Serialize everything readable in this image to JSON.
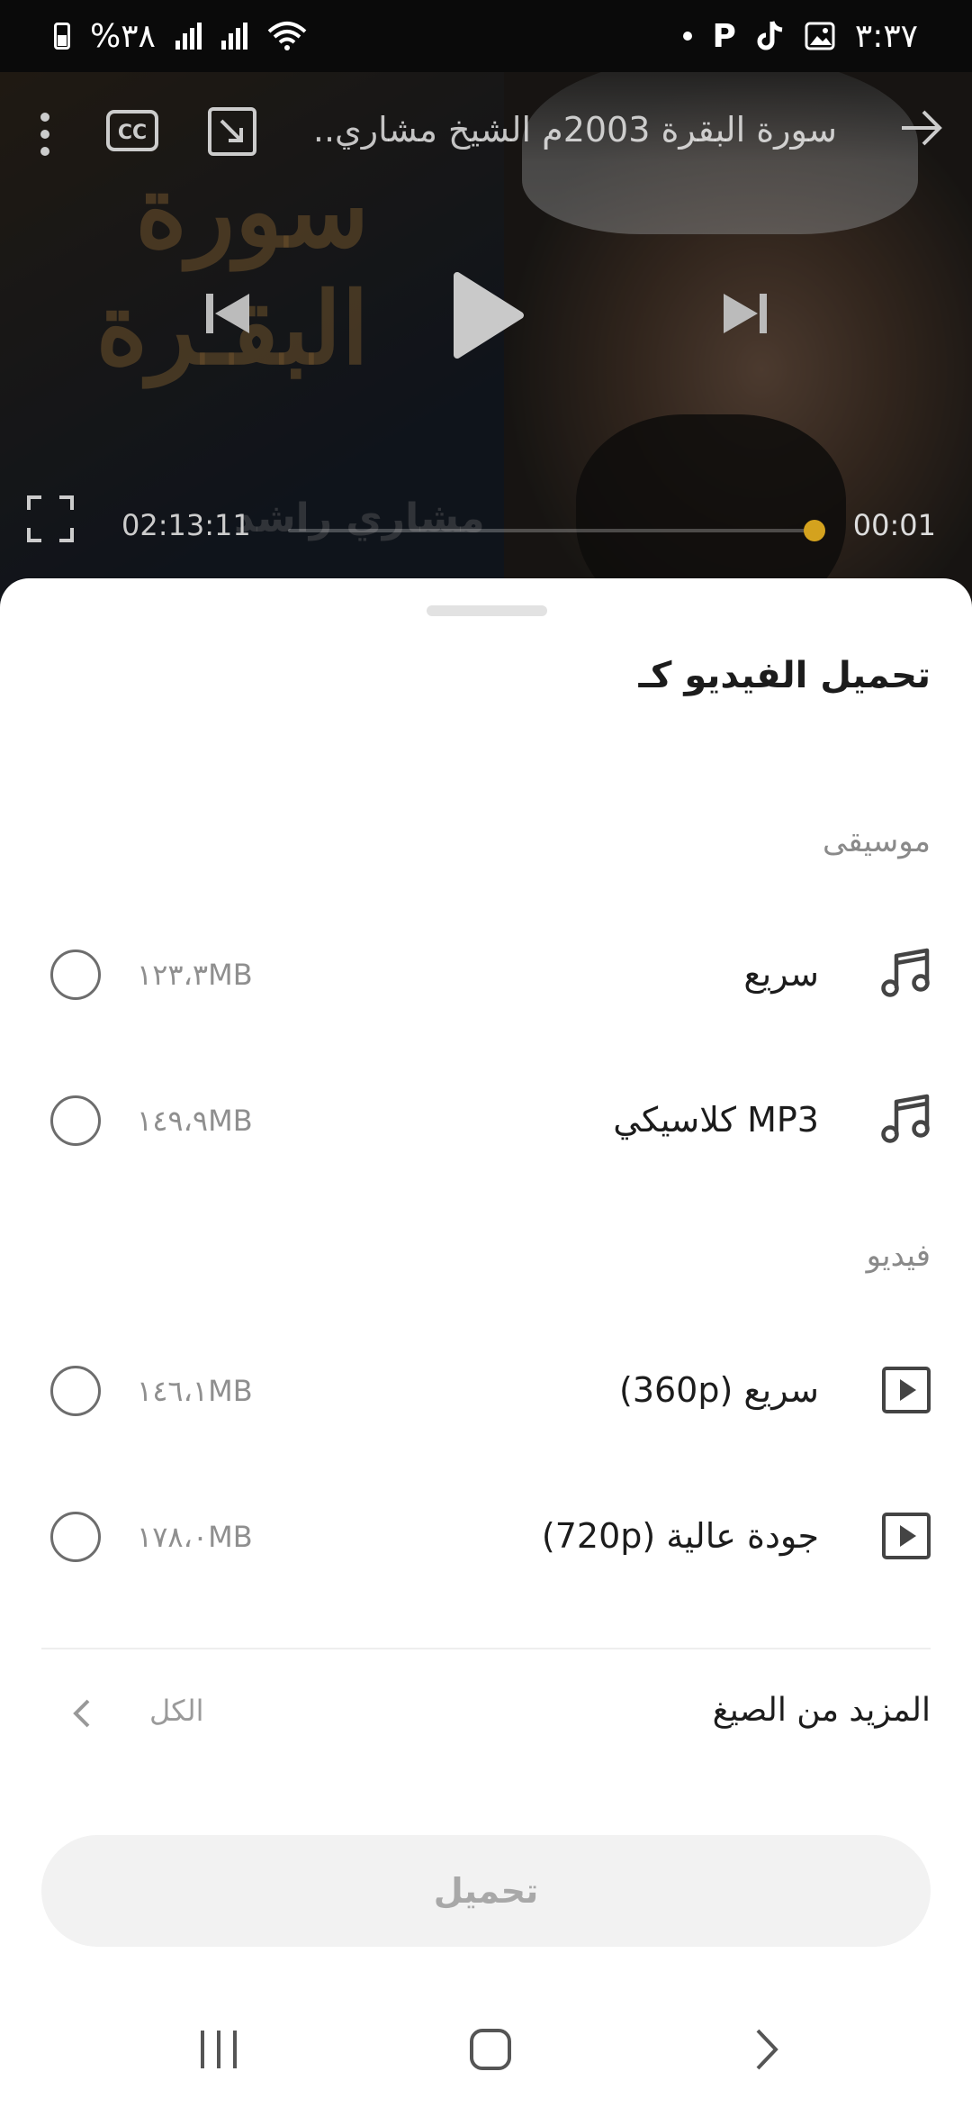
{
  "status_bar": {
    "time": "٣:٣٧",
    "battery": "%٣٨"
  },
  "player": {
    "title": "سورة البقرة 2003م الشيخ مشاري..",
    "art_text": "سورة البقـرة",
    "logo_text": "مشاري راشد",
    "time_total": "02:13:11",
    "time_current": "00:01",
    "progress": 0.01
  },
  "sheet": {
    "title": "تحميل الفيديو كـ",
    "music_section": "موسيقى",
    "video_section": "فيديو",
    "music_options": [
      {
        "label": "سريع",
        "size": "١٢٣،٣MB",
        "icon": "music-note-icon"
      },
      {
        "label": "MP3 كلاسيكي",
        "size": "١٤٩،٩MB",
        "icon": "music-note-icon"
      }
    ],
    "video_options": [
      {
        "label": "سريع (360p)",
        "size": "١٤٦،١MB",
        "icon": "video-play-icon"
      },
      {
        "label": "جودة عالية (720p)",
        "size": "١٧٨،٠MB",
        "icon": "video-play-icon"
      }
    ],
    "more_formats": "المزيد من الصيغ",
    "all": "الكل",
    "download_button": "تحميل"
  },
  "colors": {
    "accent": "#d4a21e",
    "button_bg": "#f2f2f2",
    "button_text": "#a8a8a8"
  }
}
